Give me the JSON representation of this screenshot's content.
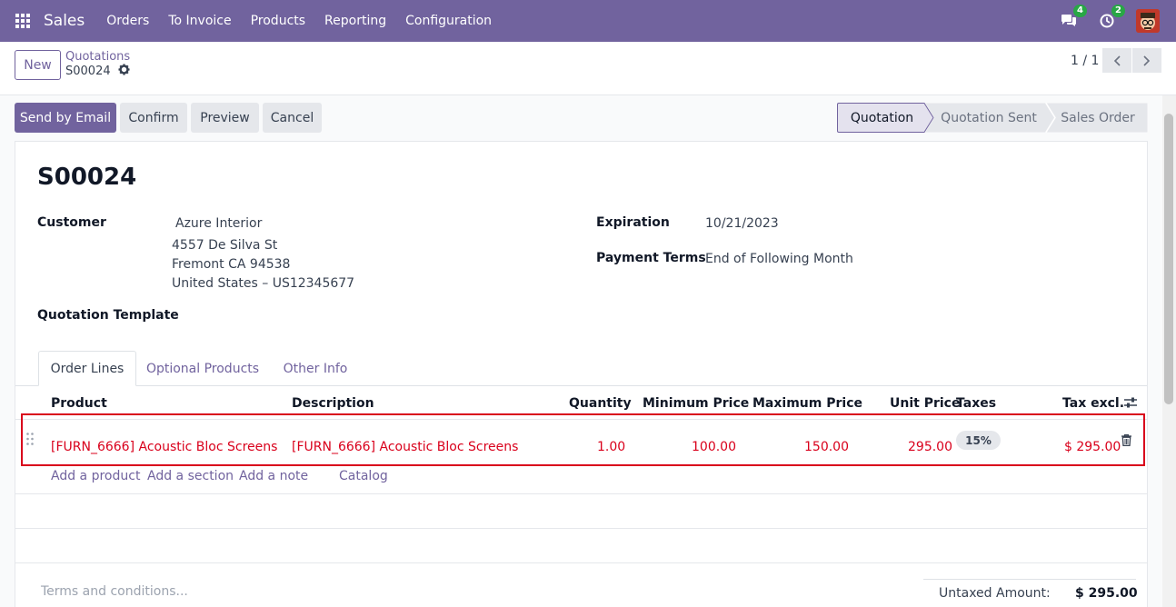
{
  "navbar": {
    "app_name": "Sales",
    "menu": [
      "Orders",
      "To Invoice",
      "Products",
      "Reporting",
      "Configuration"
    ],
    "messages_count": "4",
    "activities_count": "2",
    "accent": "#71639e"
  },
  "control": {
    "new_label": "New",
    "breadcrumb_parent": "Quotations",
    "breadcrumb_current": "S00024",
    "pager": "1 / 1"
  },
  "actions": {
    "send_email": "Send by Email",
    "confirm": "Confirm",
    "preview": "Preview",
    "cancel": "Cancel"
  },
  "stages": [
    "Quotation",
    "Quotation Sent",
    "Sales Order"
  ],
  "form": {
    "title": "S00024",
    "customer_label": "Customer",
    "customer_name": "Azure Interior",
    "address_1": "4557 De Silva St",
    "address_2": "Fremont CA 94538",
    "address_3": "United States – US12345677",
    "template_label": "Quotation Template",
    "expiration_label": "Expiration",
    "expiration_value": "10/21/2023",
    "payment_terms_label": "Payment Terms",
    "payment_terms_value": "End of Following Month"
  },
  "tabs": [
    "Order Lines",
    "Optional Products",
    "Other Info"
  ],
  "table": {
    "headers": {
      "product": "Product",
      "description": "Description",
      "quantity": "Quantity",
      "min_price": "Minimum Price",
      "max_price": "Maximum Price",
      "unit_price": "Unit Price",
      "taxes": "Taxes",
      "tax_excl": "Tax excl."
    },
    "rows": [
      {
        "product": "[FURN_6666] Acoustic Bloc Screens",
        "description": "[FURN_6666] Acoustic Bloc Screens",
        "quantity": "1.00",
        "min_price": "100.00",
        "max_price": "150.00",
        "unit_price": "295.00",
        "taxes": "15%",
        "subtotal": "$ 295.00"
      }
    ],
    "add_links": [
      "Add a product",
      "Add a section",
      "Add a note",
      "Catalog"
    ]
  },
  "footer": {
    "terms_placeholder": "Terms and conditions...",
    "untaxed_label": "Untaxed Amount:",
    "untaxed_value": "$ 295.00"
  }
}
